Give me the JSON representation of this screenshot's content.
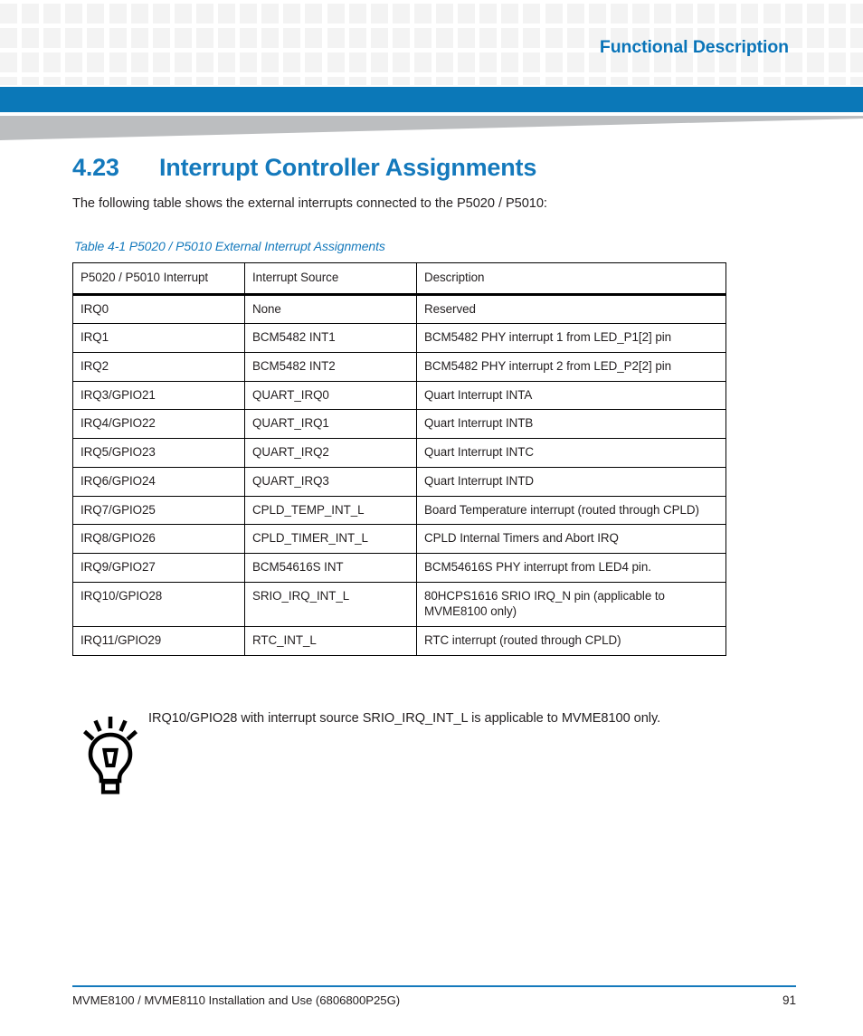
{
  "header": {
    "title": "Functional Description",
    "accent_color": "#0b78b8",
    "checker_color": "#f3f3f3",
    "wedge_color": "#bcbec0"
  },
  "section": {
    "number": "4.23",
    "title": "Interrupt Controller Assignments",
    "intro": "The following table shows the external interrupts connected to the P5020 / P5010:"
  },
  "table": {
    "caption": "Table 4-1 P5020 / P5010 External Interrupt Assignments",
    "columns": [
      "P5020 / P5010 Interrupt",
      "Interrupt Source",
      "Description"
    ],
    "rows": [
      [
        "IRQ0",
        "None",
        "Reserved"
      ],
      [
        "IRQ1",
        "BCM5482 INT1",
        "BCM5482 PHY interrupt 1 from LED_P1[2] pin"
      ],
      [
        "IRQ2",
        "BCM5482 INT2",
        "BCM5482 PHY interrupt 2 from LED_P2[2] pin"
      ],
      [
        "IRQ3/GPIO21",
        "QUART_IRQ0",
        "Quart Interrupt INTA"
      ],
      [
        "IRQ4/GPIO22",
        "QUART_IRQ1",
        "Quart Interrupt INTB"
      ],
      [
        "IRQ5/GPIO23",
        "QUART_IRQ2",
        "Quart Interrupt INTC"
      ],
      [
        "IRQ6/GPIO24",
        "QUART_IRQ3",
        "Quart Interrupt INTD"
      ],
      [
        "IRQ7/GPIO25",
        "CPLD_TEMP_INT_L",
        "Board Temperature interrupt (routed through CPLD)"
      ],
      [
        "IRQ8/GPIO26",
        "CPLD_TIMER_INT_L",
        "CPLD Internal Timers and Abort IRQ"
      ],
      [
        "IRQ9/GPIO27",
        "BCM54616S INT",
        "BCM54616S PHY interrupt from LED4 pin."
      ],
      [
        "IRQ10/GPIO28",
        "SRIO_IRQ_INT_L",
        "80HCPS1616 SRIO IRQ_N pin (applicable to MVME8100 only)"
      ],
      [
        "IRQ11/GPIO29",
        "RTC_INT_L",
        "RTC interrupt (routed through CPLD)"
      ]
    ]
  },
  "note": {
    "icon": "lightbulb-tip-icon",
    "text": "IRQ10/GPIO28 with interrupt source SRIO_IRQ_INT_L is applicable to MVME8100 only."
  },
  "footer": {
    "document": "MVME8100 / MVME8110 Installation and Use (6806800P25G)",
    "page_number": "91"
  }
}
